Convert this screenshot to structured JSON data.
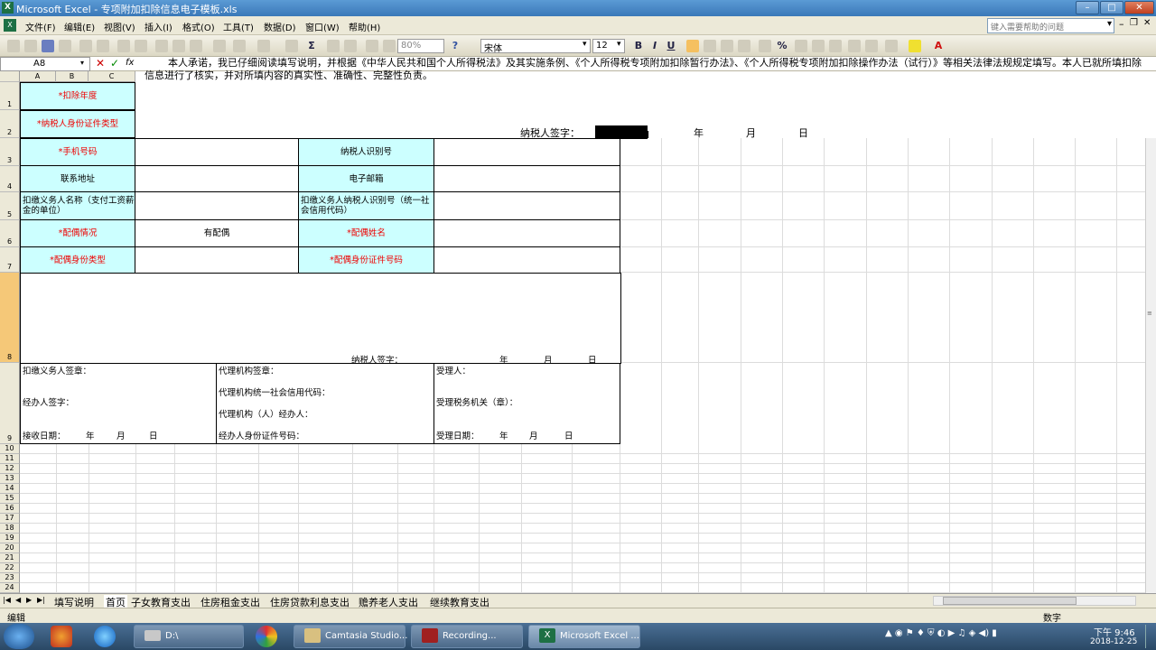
{
  "window": {
    "title": "Microsoft Excel - 专项附加扣除信息电子模板.xls",
    "app_icon": "excel-icon"
  },
  "menu": [
    "文件(F)",
    "编辑(E)",
    "视图(V)",
    "插入(I)",
    "格式(O)",
    "工具(T)",
    "数据(D)",
    "窗口(W)",
    "帮助(H)"
  ],
  "help_placeholder": "键入需要帮助的问题",
  "toolbar": {
    "zoom": "80%",
    "font": "宋体",
    "size": "12"
  },
  "namebox": "A8",
  "columns": [
    "A",
    "B",
    "C"
  ],
  "rows": [
    "1",
    "2",
    "3",
    "4",
    "5",
    "6",
    "7",
    "8",
    "9",
    "10",
    "11",
    "12",
    "13",
    "14",
    "15",
    "16",
    "17",
    "18",
    "19",
    "20",
    "21",
    "22",
    "23",
    "24"
  ],
  "header_text": {
    "promise": "本人承诺，我已仔细阅读填写说明，并根据《中华人民共和国个人所得税法》及其实施条例、《个人所得税专项附加扣除暂行办法》、《个人所得税专项附加扣除操作办法（试行）》等相关法律法规规定填写。本人已就所填扣除信息进行了核实，并对所填内容的真实性、准确性、完整性负责。",
    "sign_label": "纳税人签字：",
    "year": "年",
    "month": "月",
    "day": "日"
  },
  "form": {
    "deduct_year": "*扣除年度",
    "id_type": "*纳税人身份证件类型",
    "phone": "*手机号码",
    "taxpayer_id": "纳税人识别号",
    "address": "联系地址",
    "email": "电子邮箱",
    "withholder_name": "扣缴义务人名称（支付工资薪金的单位）",
    "withholder_id": "扣缴义务人纳税人识别号（统一社会信用代码）",
    "spouse_status": "*配偶情况",
    "spouse_status_value": "有配偶",
    "spouse_name": "*配偶姓名",
    "spouse_id_type": "*配偶身份类型",
    "spouse_id_number": "*配偶身份证件号码",
    "sign_label2": "纳税人签字：",
    "year2": "年",
    "month2": "月",
    "day2": "日"
  },
  "footer_block": {
    "withholder_seal": "扣缴义务人签章：",
    "handler_sign": "经办人签字：",
    "receive_date": "接收日期：",
    "agent_seal": "代理机构签章：",
    "agent_credit": "代理机构统一社会信用代码：",
    "agent_person": "代理机构（人）经办人：",
    "agent_id": "经办人身份证件号码：",
    "accepter": "受理人：",
    "tax_office": "受理税务机关（章）：",
    "accept_date": "受理日期：",
    "y": "年",
    "m": "月",
    "d": "日"
  },
  "sheet_tabs": [
    "填写说明",
    "首页",
    "子女教育支出",
    "住房租金支出",
    "住房贷款利息支出",
    "赡养老人支出",
    "继续教育支出"
  ],
  "status": {
    "mode": "编辑",
    "num": "数字"
  },
  "taskbar": {
    "items": [
      "D:\\",
      "Camtasia Studio...",
      "Recording...",
      "Microsoft Excel ..."
    ],
    "time": "下午 9:46",
    "date": "2018-12-25"
  }
}
